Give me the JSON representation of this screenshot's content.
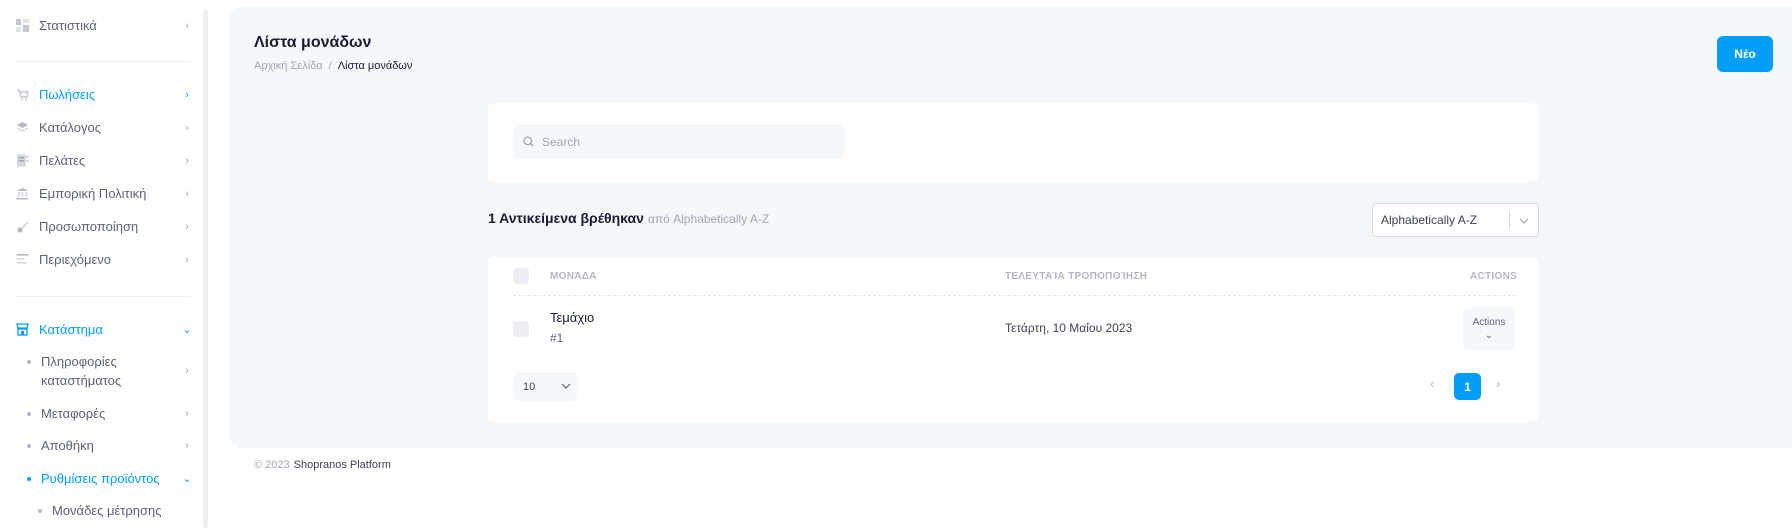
{
  "sidebar": {
    "stats": "Στατιστικά",
    "sales": "Πωλήσεις",
    "catalog": "Κατάλογος",
    "customers": "Πελάτες",
    "commercial_policy": "Εμπορική Πολιτική",
    "personalization": "Προσωποποίηση",
    "content": "Περιεχόμενο",
    "store": "Κατάστημα",
    "store_info_line1": "Πληροφορίες",
    "store_info_line2": "καταστήματος",
    "shipping": "Μεταφορές",
    "warehouse": "Αποθήκη",
    "product_settings": "Ρυθμίσεις προϊόντος",
    "units": "Μονάδες μέτρησης"
  },
  "header": {
    "title": "Λίστα μονάδων",
    "breadcrumb_home": "Αρχική Σελίδα",
    "breadcrumb_sep": "/",
    "breadcrumb_current": "Λίστα μονάδων",
    "new_button": "Νέο"
  },
  "search": {
    "placeholder": "Search"
  },
  "results": {
    "count_text": "1 Αντικείμενα βρέθηκαν",
    "sort_suffix": "από Alphabetically A-Z",
    "sort_value": "Alphabetically A-Z"
  },
  "table": {
    "columns": [
      "ΜΟΝΆΔΑ",
      "ΤΕΛΕΥΤΑΊΑ ΤΡΟΠΟΠΟΊΗΣΗ",
      "ACTIONS"
    ],
    "rows": [
      {
        "name": "Τεμάχιο",
        "id": "#1",
        "updated": "Τετάρτη, 10 Μαΐου 2023",
        "actions": "Actions"
      }
    ]
  },
  "pagination": {
    "page_size": "10",
    "current_page": "1"
  },
  "footer": {
    "year": "© 2023",
    "brand": "Shopranos Platform"
  },
  "colors": {
    "accent": "#009ef7",
    "background": "#f5f8fa",
    "text_dark": "#181c32",
    "muted": "#a1a5b7"
  }
}
